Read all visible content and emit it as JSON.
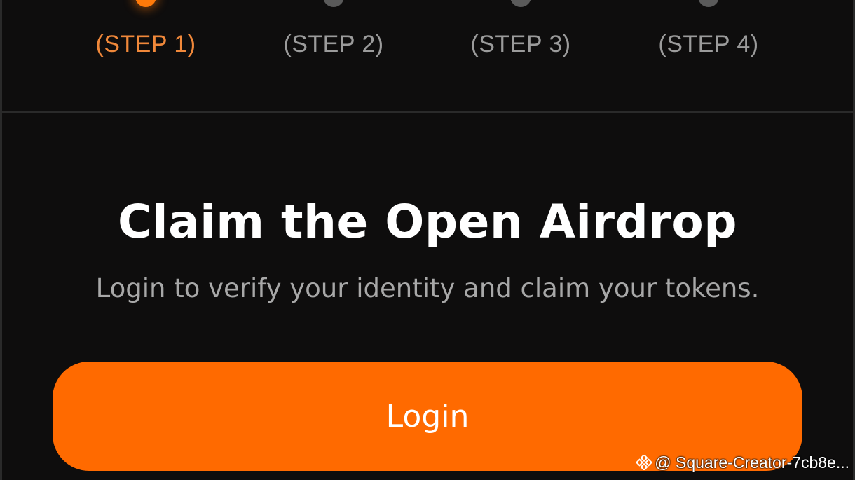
{
  "steps": [
    {
      "label": "(STEP 1)",
      "active": true
    },
    {
      "label": "(STEP 2)",
      "active": false
    },
    {
      "label": "(STEP 3)",
      "active": false
    },
    {
      "label": "(STEP 4)",
      "active": false
    }
  ],
  "main": {
    "title": "Claim the Open Airdrop",
    "subtitle": "Login to verify your identity and claim your tokens.",
    "login_label": "Login"
  },
  "watermark": {
    "text": "@ Square-Creator-7cb8e..."
  },
  "colors": {
    "accent": "#ff6a00",
    "active_step": "#f0883a",
    "inactive_step": "#9b9b9b",
    "background": "#0e0d0d"
  },
  "icons": {
    "watermark_icon": "binance-logo-icon"
  }
}
